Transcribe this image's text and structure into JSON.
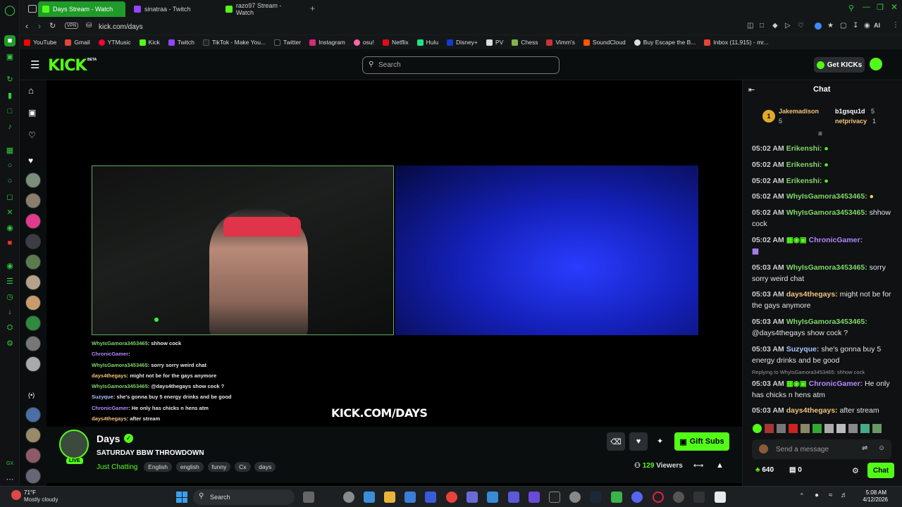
{
  "browser": {
    "tabs": [
      {
        "label": "Days Stream - Watch"
      },
      {
        "label": "sinatraa - Twitch"
      },
      {
        "label": "razo97 Stream - Watch"
      }
    ],
    "vpn": "VPN",
    "url": "kick.com/days",
    "ai": "AI",
    "bookmarks": [
      "YouTube",
      "Gmail",
      "YTMusic",
      "Kick",
      "Twitch",
      "TikTok - Make You...",
      "Twitter",
      "Instagram",
      "osu!",
      "Netflix",
      "Hulu",
      "Disney+",
      "PV",
      "Chess",
      "Vimm's",
      "SoundCloud",
      "Buy Escape the B...",
      "Inbox (11,915) - mr..."
    ]
  },
  "header": {
    "logo": "KICK",
    "beta": "BETA",
    "search_placeholder": "Search",
    "get_kicks": "Get KICKs"
  },
  "player": {
    "overlay_chat": [
      {
        "user": "WhyIsGamora3453465",
        "text": ": shhow cock",
        "color": "#7dd96a"
      },
      {
        "user": "ChronicGamer",
        "text": ":",
        "color": "#b388ff"
      },
      {
        "user": "WhyIsGamora3453465",
        "text": ": sorry sorry weird chat",
        "color": "#7dd96a"
      },
      {
        "user": "days4thegays",
        "text": ": might not be for the gays anymore",
        "color": "#f4c27a"
      },
      {
        "user": "WhyIsGamora3453465",
        "text": ": @days4thegays show cock ?",
        "color": "#7dd96a"
      },
      {
        "user": "Suzyque",
        "text": ": she's gonna buy 5 energy drinks and be good",
        "color": "#a9c7ff"
      },
      {
        "user": "ChronicGamer",
        "text": ": He only has chicks n hens atm",
        "color": "#b388ff"
      },
      {
        "user": "days4thegays",
        "text": ": after stream",
        "color": "#f4c27a"
      }
    ],
    "brand": "KICK.COM/DAYS"
  },
  "stream": {
    "channel": "Days",
    "live": "LIVE",
    "title": "SATURDAY BBW THROWDOWN",
    "category": "Just Chatting",
    "tags": [
      "English",
      "english",
      "funny",
      "Cx",
      "days"
    ],
    "viewers": "129",
    "viewers_label": "Viewers",
    "gift_subs": "Gift Subs"
  },
  "chat": {
    "title": "Chat",
    "leaderboard": [
      {
        "rank": "1",
        "name": "Jakemadison",
        "count": "5"
      },
      {
        "name": "b1gsqu1d",
        "count": "5"
      },
      {
        "name": "netprivacy",
        "count": "1"
      }
    ],
    "messages": [
      {
        "time": "05:02 AM",
        "user": "Erikenshi:",
        "text": "",
        "color": "#7dd96a"
      },
      {
        "time": "05:02 AM",
        "user": "Erikenshi:",
        "text": "",
        "color": "#7dd96a"
      },
      {
        "time": "05:02 AM",
        "user": "Erikenshi:",
        "text": "",
        "color": "#7dd96a"
      },
      {
        "time": "05:02 AM",
        "user": "WhyIsGamora3453465:",
        "text": "",
        "color": "#7dd96a"
      },
      {
        "time": "05:02 AM",
        "user": "WhyIsGamora3453465:",
        "text": "shhow cock",
        "color": "#7dd96a"
      },
      {
        "time": "05:02 AM",
        "user": "ChronicGamer:",
        "text": "",
        "color": "#b388ff"
      },
      {
        "time": "05:03 AM",
        "user": "WhyIsGamora3453465:",
        "text": "sorry sorry weird chat",
        "color": "#7dd96a"
      },
      {
        "time": "05:03 AM",
        "user": "days4thegays:",
        "text": "might not be for the gays anymore",
        "color": "#f4c27a"
      },
      {
        "time": "05:03 AM",
        "user": "WhyIsGamora3453465:",
        "text": "@days4thegays show cock ?",
        "color": "#7dd96a"
      },
      {
        "time": "05:03 AM",
        "user": "Suzyque:",
        "text": "she's gonna buy 5 energy drinks and be good",
        "color": "#a9c7ff"
      },
      {
        "time": "05:03 AM",
        "user": "ChronicGamer:",
        "text": "He only has chicks n hens atm",
        "color": "#b388ff"
      },
      {
        "time": "05:03 AM",
        "user": "days4thegays:",
        "text": "after stream",
        "color": "#f4c27a"
      }
    ],
    "reply_hint": "Replying to WhyIsGamora3453465: shhow cock",
    "input_placeholder": "Send a message",
    "points": "640",
    "second_count": "0",
    "chat_button": "Chat"
  },
  "taskbar": {
    "weather_temp": "71°F",
    "weather_desc": "Mostly cloudy",
    "search": "Search",
    "time": "5:08 AM",
    "date": "4/12/2026"
  },
  "colors": {
    "kick_green": "#53fc18",
    "tab_green": "#1f9b2a"
  }
}
